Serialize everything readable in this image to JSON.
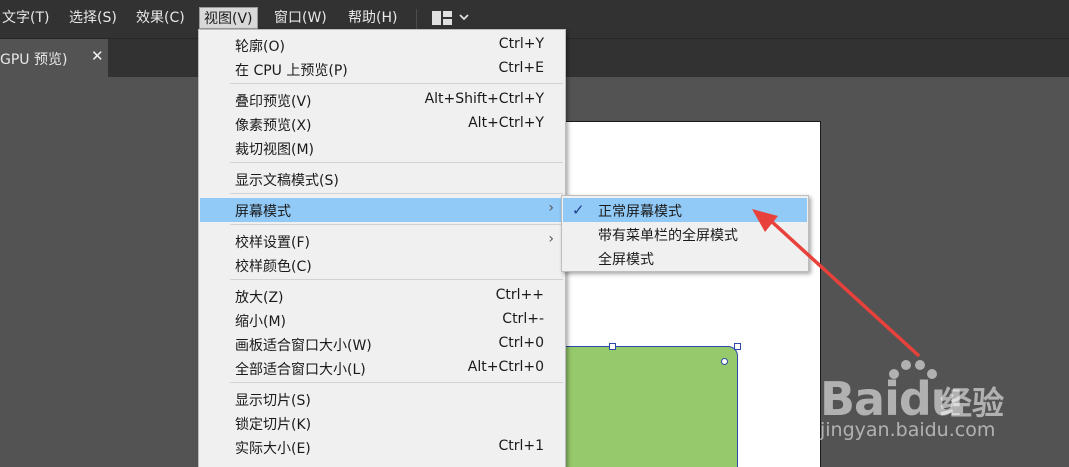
{
  "menubar": {
    "items": [
      "文字(T)",
      "选择(S)",
      "效果(C)",
      "视图(V)",
      "窗口(W)",
      "帮助(H)"
    ],
    "active_index": 3
  },
  "workspace_switcher": {
    "icon": "workspace-grid-icon",
    "chevron": "⌄"
  },
  "document_tab": {
    "label": "GPU 预览)",
    "close": "✕"
  },
  "view_menu": {
    "items": [
      {
        "label": "轮廓(O)",
        "shortcut": "Ctrl+Y"
      },
      {
        "label": "在 CPU 上预览(P)",
        "shortcut": "Ctrl+E"
      },
      {
        "label": "叠印预览(V)",
        "shortcut": "Alt+Shift+Ctrl+Y"
      },
      {
        "label": "像素预览(X)",
        "shortcut": "Alt+Ctrl+Y"
      },
      {
        "label": "裁切视图(M)",
        "shortcut": ""
      },
      {
        "label": "显示文稿模式(S)",
        "shortcut": ""
      },
      {
        "label": "屏幕模式",
        "shortcut": "",
        "submenu": true,
        "highlighted": true
      },
      {
        "label": "校样设置(F)",
        "shortcut": "",
        "submenu": true
      },
      {
        "label": "校样颜色(C)",
        "shortcut": ""
      },
      {
        "label": "放大(Z)",
        "shortcut": "Ctrl++"
      },
      {
        "label": "缩小(M)",
        "shortcut": "Ctrl+-"
      },
      {
        "label": "画板适合窗口大小(W)",
        "shortcut": "Ctrl+0"
      },
      {
        "label": "全部适合窗口大小(L)",
        "shortcut": "Alt+Ctrl+0"
      },
      {
        "label": "显示切片(S)",
        "shortcut": ""
      },
      {
        "label": "锁定切片(K)",
        "shortcut": ""
      },
      {
        "label": "实际大小(E)",
        "shortcut": "Ctrl+1"
      }
    ],
    "submenu_arrow": "›"
  },
  "screen_mode_submenu": {
    "items": [
      {
        "label": "正常屏幕模式",
        "checked": true
      },
      {
        "label": "带有菜单栏的全屏模式",
        "checked": false
      },
      {
        "label": "全屏模式",
        "checked": false
      }
    ],
    "check_glyph": "✓"
  },
  "annotation": {
    "color": "#e8413b"
  },
  "watermark": {
    "logo": "Bai",
    "logo_tail": "du",
    "suffix": "经验",
    "url": "jingyan.baidu.com"
  },
  "colors": {
    "menu_highlight": "#91c9f7",
    "shape_fill": "#95c96b",
    "selection": "#2c4aa8"
  }
}
